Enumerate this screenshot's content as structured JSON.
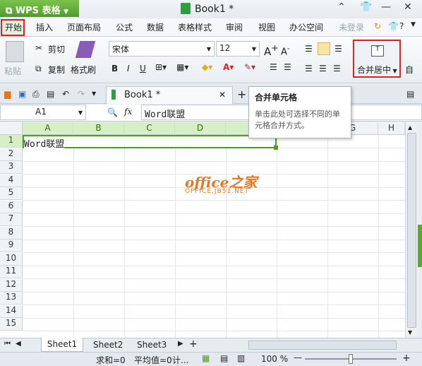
{
  "app": {
    "name": "WPS 表格",
    "doc_title": "Book1 *"
  },
  "menu": [
    "开始",
    "插入",
    "页面布局",
    "公式",
    "数据",
    "表格样式",
    "审阅",
    "视图",
    "办公空间"
  ],
  "login_label": "未登录",
  "clipboard": {
    "paste": "粘贴",
    "cut": "剪切",
    "copy": "复制",
    "format_painter": "格式刷"
  },
  "font": {
    "name": "宋体",
    "size": "12"
  },
  "format_buttons": [
    "B",
    "I",
    "U"
  ],
  "merge": {
    "label": "合并居中",
    "next_label": "自"
  },
  "doc_tab": {
    "label": "Book1 *"
  },
  "formula": {
    "cell_ref": "A1",
    "fx": "fx",
    "value": "Word联盟"
  },
  "tooltip": {
    "title": "合并单元格",
    "desc": "单击此处可选择不同的单元格合并方式。"
  },
  "columns": [
    "A",
    "B",
    "C",
    "D",
    "G",
    "H"
  ],
  "rows": [
    "1",
    "2",
    "3",
    "4",
    "5",
    "6",
    "7",
    "8",
    "9",
    "10",
    "11",
    "12",
    "13",
    "14",
    "15"
  ],
  "cells": {
    "A1": "Word联盟"
  },
  "watermark": {
    "brand": "office之家",
    "url": "OFFICE.JB51.NET"
  },
  "sheets": [
    "Sheet1",
    "Sheet2",
    "Sheet3"
  ],
  "status": {
    "sum": "求和=0",
    "avg": "平均值=0",
    "count": "计...",
    "zoom": "100 %"
  },
  "colors": {
    "accent_green": "#4f9c2b",
    "highlight_red": "#d22222"
  }
}
